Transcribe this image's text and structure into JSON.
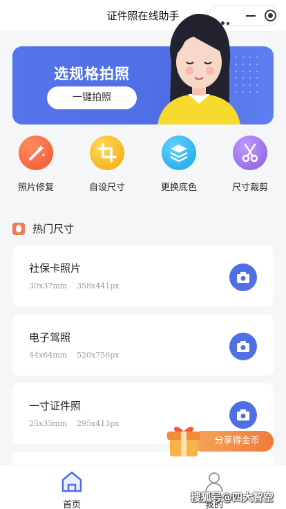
{
  "titlebar": {
    "title": "证件照在线助手"
  },
  "banner": {
    "headline": "选规格拍照",
    "cta_label": "一键拍照"
  },
  "features": [
    {
      "label": "照片修复",
      "icon": "magic-wand-icon",
      "color": "#f26a45"
    },
    {
      "label": "自设尺寸",
      "icon": "crop-icon",
      "color": "#f5b50f"
    },
    {
      "label": "更换底色",
      "icon": "layers-icon",
      "color": "#23b4ef"
    },
    {
      "label": "尺寸裁剪",
      "icon": "scissors-icon",
      "color": "#9b72e6"
    }
  ],
  "section": {
    "title": "热门尺寸"
  },
  "sizes": [
    {
      "name": "社保卡照片",
      "mm": "30x37mm",
      "px": "358x441px"
    },
    {
      "name": "电子驾照",
      "mm": "44x64mm",
      "px": "520x756px"
    },
    {
      "name": "一寸证件照",
      "mm": "25x35mm",
      "px": "295x413px"
    }
  ],
  "promo": {
    "label": "分享得金币"
  },
  "tabbar": {
    "tabs": [
      {
        "label": "首页",
        "icon": "home-icon"
      },
      {
        "label": "我的",
        "icon": "user-icon"
      }
    ]
  },
  "watermark": {
    "text": "搜狐号@四大智空"
  },
  "colors": {
    "accent": "#4f6fe3",
    "background": "#f4f6f8"
  }
}
